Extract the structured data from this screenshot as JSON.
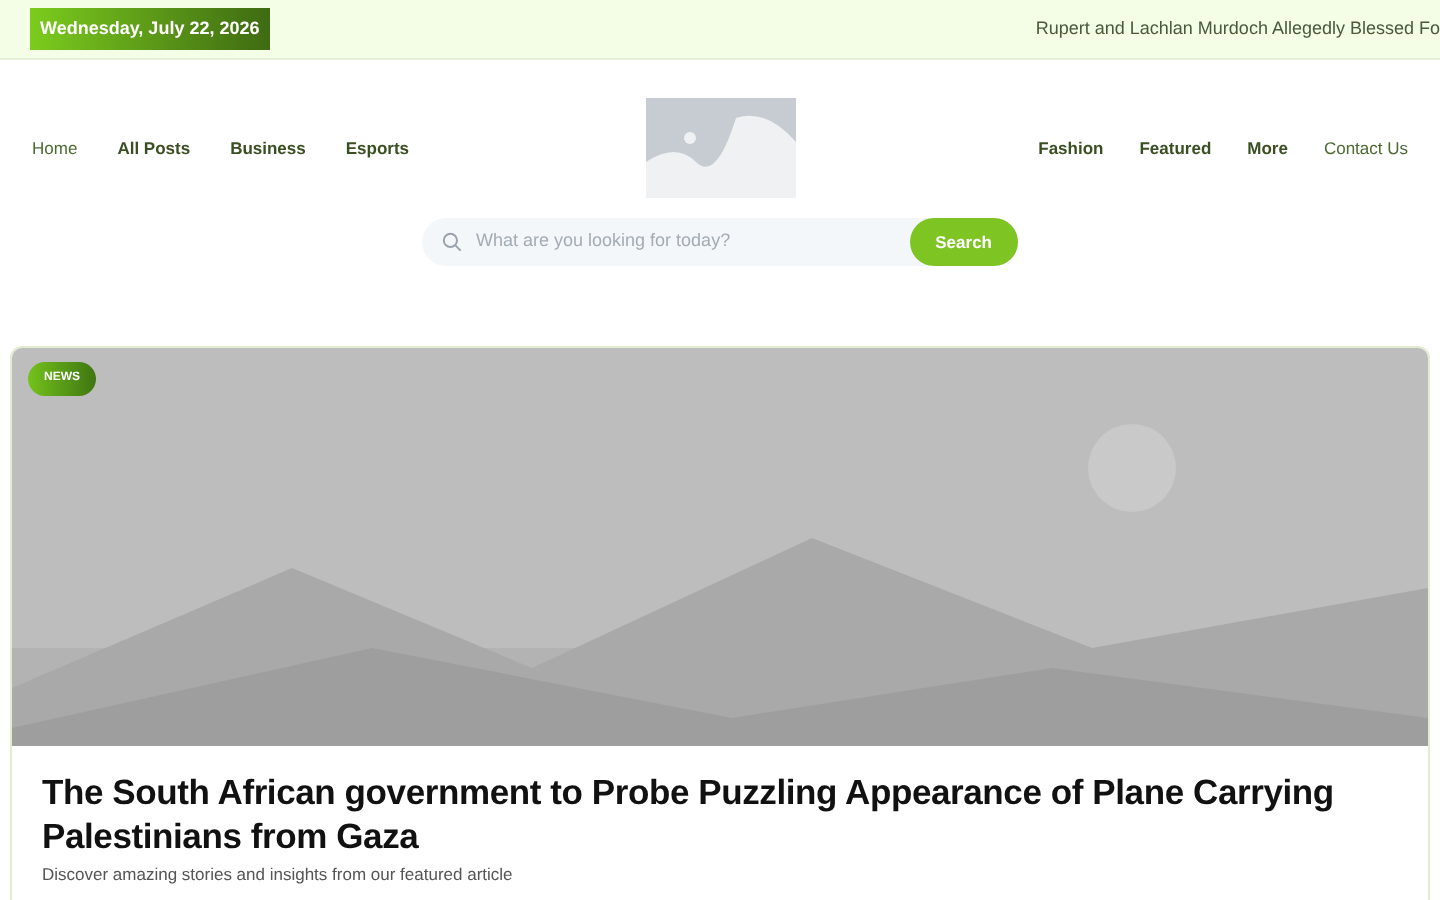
{
  "top_bar": {
    "date": "Wednesday, July 22, 2026",
    "ticker": "Rupert and Lachlan Murdoch Allegedly Blessed Fo"
  },
  "nav_left": [
    {
      "label": "Home",
      "kind": "page"
    },
    {
      "label": "All Posts",
      "kind": "category"
    },
    {
      "label": "Business",
      "kind": "category"
    },
    {
      "label": "Esports",
      "kind": "category"
    }
  ],
  "nav_right": [
    {
      "label": "Fashion",
      "kind": "category"
    },
    {
      "label": "Featured",
      "kind": "category"
    },
    {
      "label": "More",
      "kind": "category"
    },
    {
      "label": "Contact Us",
      "kind": "page"
    }
  ],
  "search": {
    "placeholder": "What are you looking for today?",
    "button": "Search"
  },
  "featured": {
    "badge": "NEWS",
    "title": "The South African government to Probe Puzzling Appearance of Plane Carrying Palestinians from Gaza",
    "excerpt": "Discover amazing stories and insights from our featured article"
  }
}
